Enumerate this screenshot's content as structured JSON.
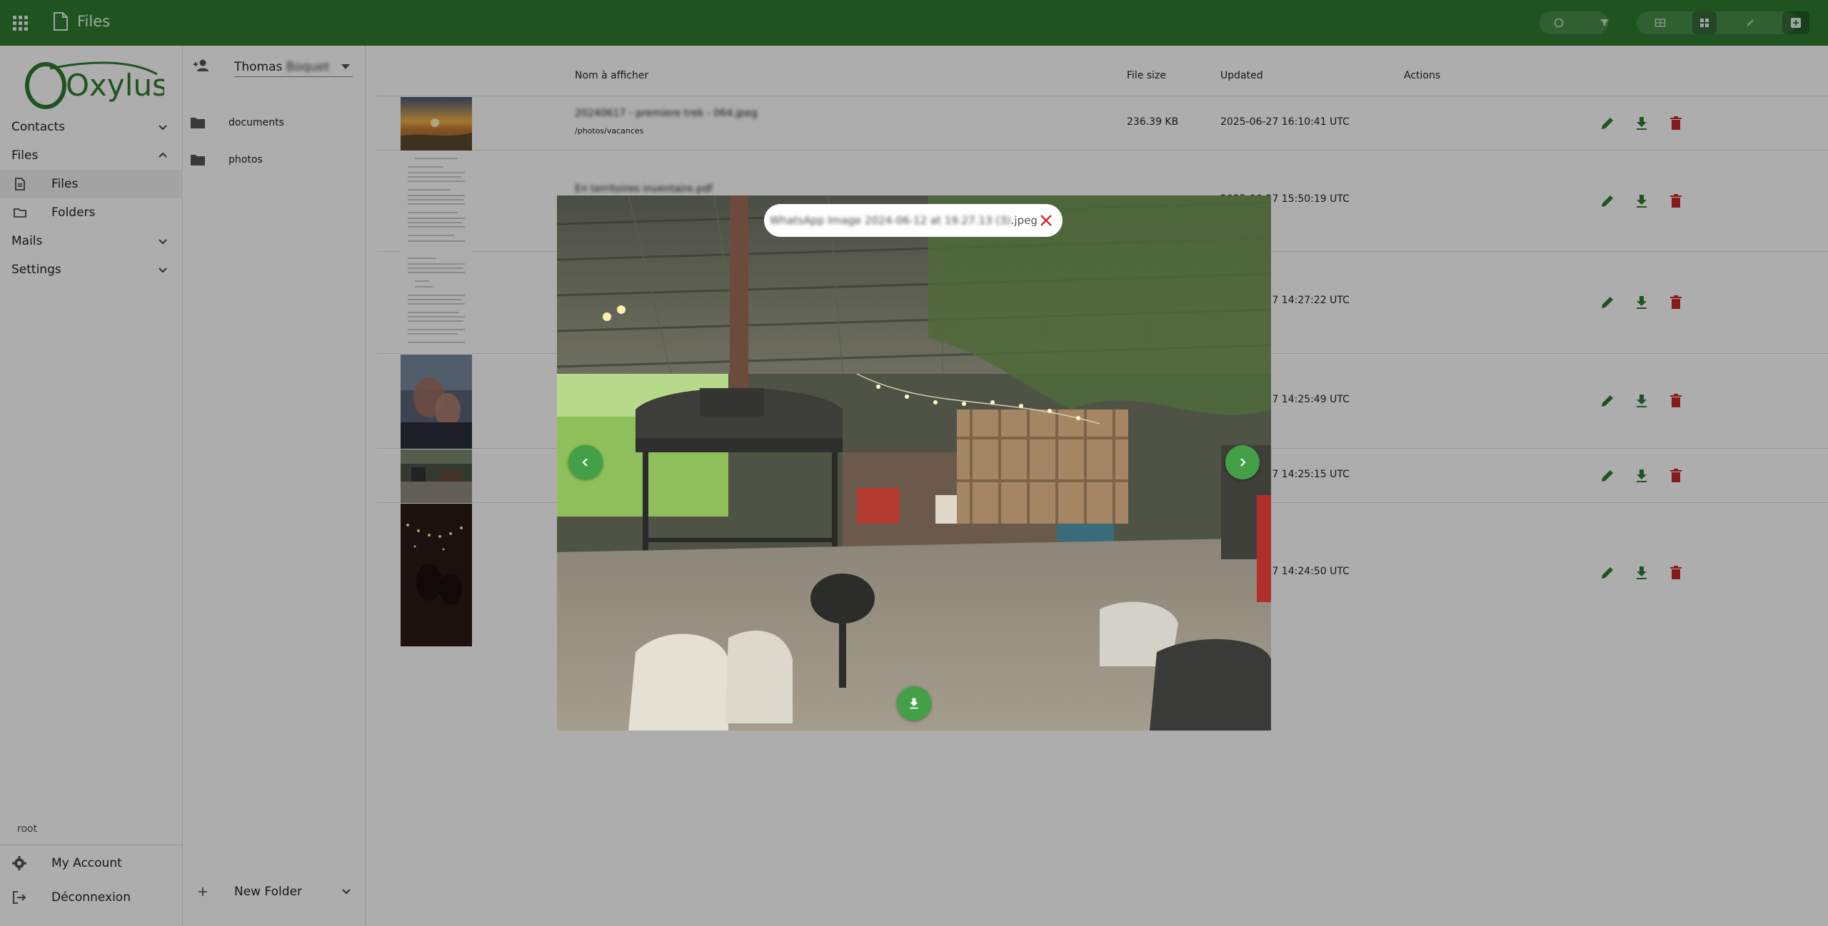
{
  "app": {
    "title": "Files",
    "brand_name": "Oxylus",
    "accent": "#2e7d32",
    "danger": "#c62828"
  },
  "sidebar": {
    "items": [
      {
        "label": "Contacts",
        "icon": "chevron-down-icon"
      },
      {
        "label": "Files",
        "icon": "chevron-up-icon"
      },
      {
        "label": "Files",
        "icon": "file-icon"
      },
      {
        "label": "Folders",
        "icon": "folder-icon"
      },
      {
        "label": "Mails",
        "icon": "chevron-down-icon"
      },
      {
        "label": "Settings",
        "icon": "chevron-down-icon"
      }
    ],
    "user": "root",
    "footer": [
      {
        "label": "My Account",
        "icon": "gear-icon"
      },
      {
        "label": "Déconnexion",
        "icon": "logout-icon"
      }
    ]
  },
  "folders": {
    "owner_first": "Thomas",
    "owner_rest": "Boquet",
    "items": [
      {
        "label": "documents"
      },
      {
        "label": "photos"
      }
    ],
    "new_folder_label": "New Folder"
  },
  "table": {
    "headers": {
      "name": "Nom à afficher",
      "size": "File size",
      "updated": "Updated",
      "actions": "Actions"
    },
    "rows": [
      {
        "name": "20240617 - premiere trek - 064.jpeg",
        "path": "/photos/vacances",
        "size": "236.39 KB",
        "updated": "2025-06-27 16:10:41 UTC"
      },
      {
        "name": "En territoires inventaire.pdf",
        "path": "",
        "size": "",
        "updated": "2025-06-27 15:50:19 UTC"
      },
      {
        "name": "",
        "path": "",
        "size": "",
        "updated": "2025-06-27 14:27:22 UTC"
      },
      {
        "name": "",
        "path": "",
        "size": "",
        "updated": "2025-06-27 14:25:49 UTC"
      },
      {
        "name": "",
        "path": "",
        "size": "",
        "updated": "2025-06-27 14:25:15 UTC"
      },
      {
        "name": "",
        "path": "",
        "size": "",
        "updated": "2025-06-27 14:24:50 UTC"
      }
    ]
  },
  "viewer": {
    "filename": "WhatsApp Image 2024-06-12 at 19.27.13 (3)",
    "extension": ".jpeg"
  }
}
